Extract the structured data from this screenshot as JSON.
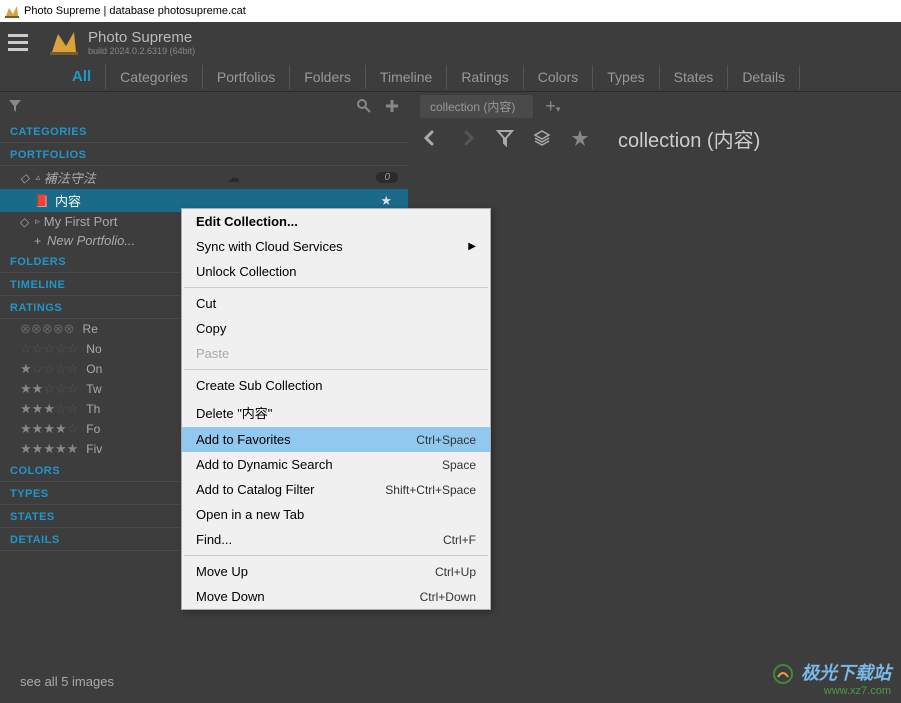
{
  "window": {
    "title": "Photo Supreme | database photosupreme.cat"
  },
  "app": {
    "name": "Photo Supreme",
    "build": "build 2024.0.2.6319 (64bit)"
  },
  "nav": {
    "all": "All",
    "tabs": [
      "Categories",
      "Portfolios",
      "Folders",
      "Timeline",
      "Ratings",
      "Colors",
      "Types",
      "States",
      "Details"
    ]
  },
  "sections": {
    "categories": "CATEGORIES",
    "portfolios": "PORTFOLIOS",
    "folders": "FOLDERS",
    "timeline": "TIMELINE",
    "ratings": "RATINGS",
    "colors": "COLORS",
    "types": "TYPES",
    "states": "STATES",
    "details": "DETAILS"
  },
  "portfolios": {
    "item1": "補法守法",
    "item1_badge": "0",
    "item2": "内容",
    "item3": "My First Port",
    "new": "New Portfolio..."
  },
  "ratings": {
    "r0": "Re",
    "r1": "No",
    "r2": "On",
    "r3": "Tw",
    "r4": "Th",
    "r5": "Fo",
    "r6": "Fiv"
  },
  "footer": {
    "text": "see all 5 images"
  },
  "content": {
    "tab_label": "collection (内容)",
    "title": "collection (内容)"
  },
  "menu": {
    "edit": "Edit Collection...",
    "sync": "Sync with Cloud Services",
    "unlock": "Unlock Collection",
    "cut": "Cut",
    "copy": "Copy",
    "paste": "Paste",
    "create_sub": "Create Sub Collection",
    "delete": "Delete \"内容\"",
    "add_fav": "Add to Favorites",
    "add_fav_key": "Ctrl+Space",
    "add_dyn": "Add to Dynamic Search",
    "add_dyn_key": "Space",
    "add_cat": "Add to Catalog Filter",
    "add_cat_key": "Shift+Ctrl+Space",
    "open_tab": "Open in a new Tab",
    "find": "Find...",
    "find_key": "Ctrl+F",
    "move_up": "Move Up",
    "move_up_key": "Ctrl+Up",
    "move_down": "Move Down",
    "move_down_key": "Ctrl+Down"
  },
  "watermark": {
    "line1": "极光下载站",
    "line2": "www.xz7.com"
  }
}
